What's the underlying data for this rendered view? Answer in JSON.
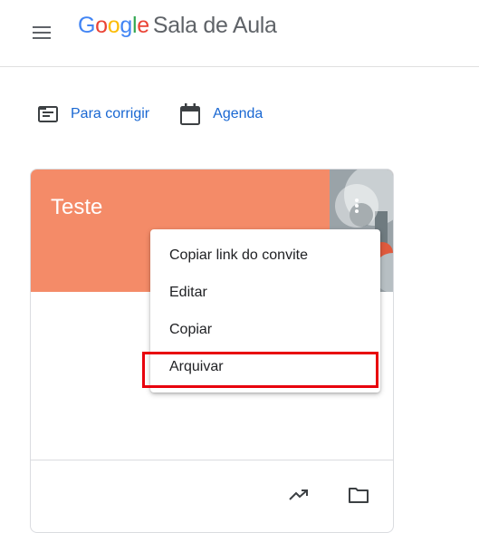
{
  "header": {
    "menu_icon": "hamburger-menu-icon",
    "logo_letters": [
      "G",
      "o",
      "o",
      "g",
      "l",
      "e"
    ],
    "logo_colors": [
      "#4285f4",
      "#ea4335",
      "#fbbc05",
      "#4285f4",
      "#34a853",
      "#ea4335"
    ],
    "product_name": "Sala de Aula"
  },
  "quicklinks": [
    {
      "label": "Para corrigir",
      "icon": "to-review-icon"
    },
    {
      "label": "Agenda",
      "icon": "calendar-icon"
    }
  ],
  "class_card": {
    "title": "Teste",
    "header_color": "#f48b68",
    "more_icon": "more-vert-icon",
    "footer_icons": [
      "trending-icon",
      "folder-icon"
    ]
  },
  "context_menu": {
    "items": [
      {
        "label": "Copiar link do convite"
      },
      {
        "label": "Editar"
      },
      {
        "label": "Copiar"
      },
      {
        "label": "Arquivar"
      }
    ],
    "highlighted_item": "Arquivar",
    "highlight_color": "#e8000d"
  },
  "accent_color": "#1967d2"
}
